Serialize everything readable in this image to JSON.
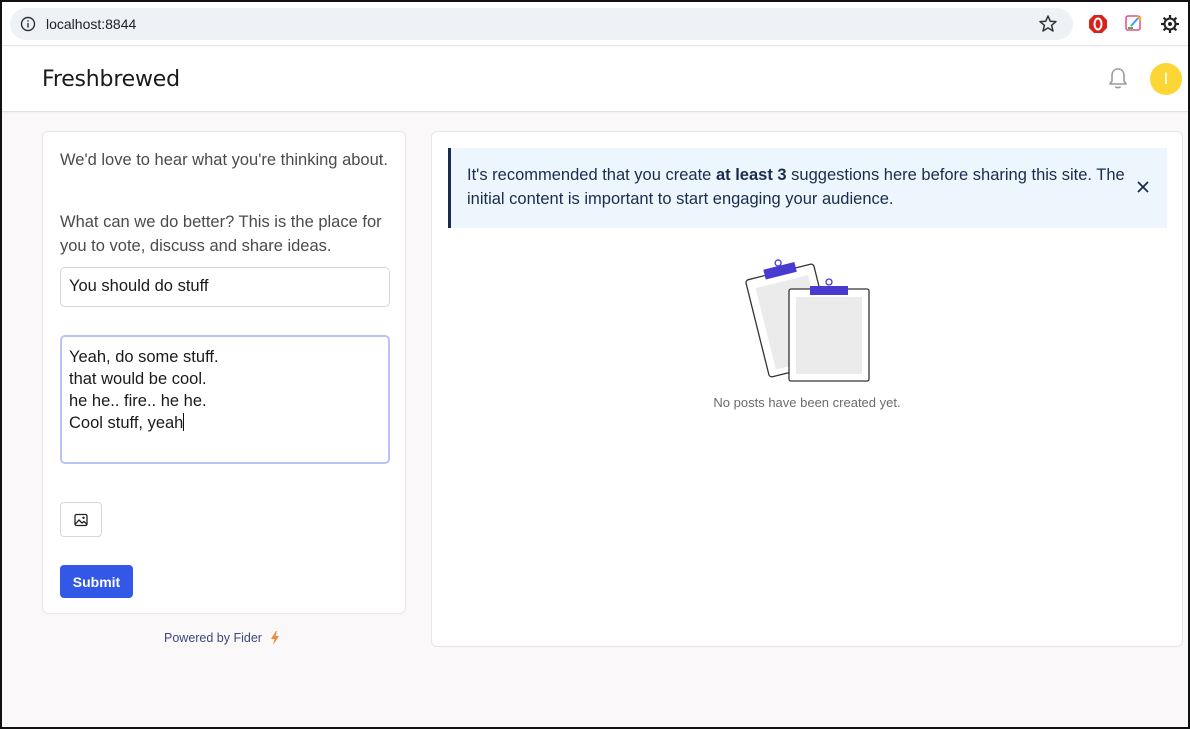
{
  "browser": {
    "url": "localhost:8844"
  },
  "header": {
    "site_title": "Freshbrewed",
    "avatar_initial": "I",
    "avatar_color": "#fcd635"
  },
  "left": {
    "intro1": "We'd love to hear what you're thinking about.",
    "intro2": "What can we do better? This is the place for you to vote, discuss and share ideas.",
    "title_value": "You should do stuff",
    "description_lines": [
      "Yeah, do some stuff.",
      "that would be cool.",
      "he he.. fire.. he he.",
      "Cool stuff, yeah"
    ],
    "submit_label": "Submit",
    "powered_by": "Powered by Fider"
  },
  "right": {
    "alert_prefix": "It's recommended that you create ",
    "alert_bold": "at least 3",
    "alert_suffix": " suggestions here before sharing this site. The initial content is important to start engaging your audience.",
    "empty_message": "No posts have been created yet."
  },
  "colors": {
    "accent": "#3358e8",
    "alert_bg": "#edf6fc",
    "alert_border": "#1a2c4d"
  }
}
